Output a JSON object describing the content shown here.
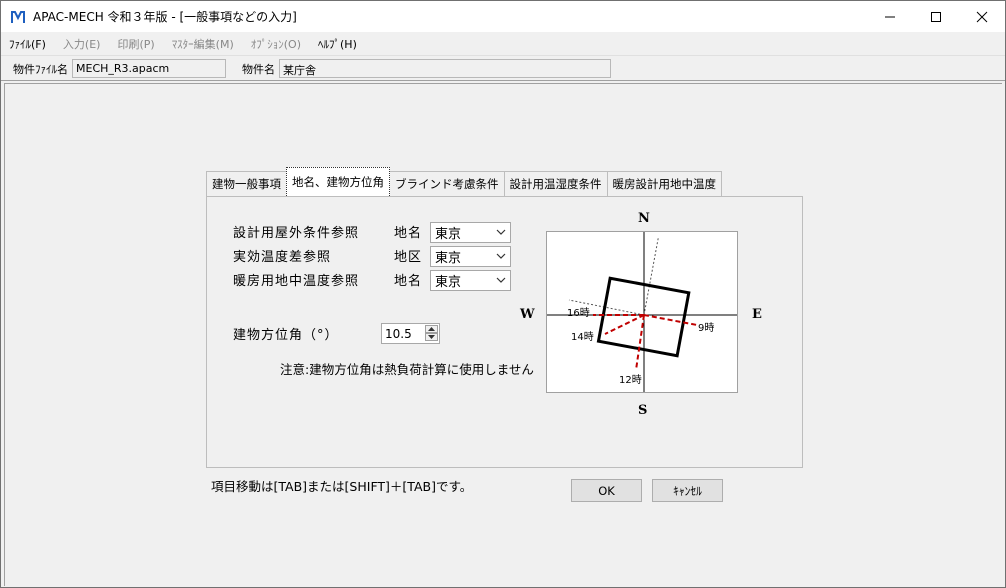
{
  "window": {
    "title": "APAC-MECH 令和３年版 - [一般事項などの入力]"
  },
  "menu": [
    {
      "label": "ﾌｧｲﾙ(F)",
      "enabled": true
    },
    {
      "label": "入力(E)",
      "enabled": false
    },
    {
      "label": "印刷(P)",
      "enabled": false
    },
    {
      "label": "ﾏｽﾀｰ編集(M)",
      "enabled": false
    },
    {
      "label": "ｵﾌﾟｼｮﾝ(O)",
      "enabled": false
    },
    {
      "label": "ﾍﾙﾌﾟ(H)",
      "enabled": true
    }
  ],
  "info": {
    "file_label": "物件ﾌｧｲﾙ名",
    "file_value": "MECH_R3.apacm",
    "name_label": "物件名",
    "name_value": "某庁舎"
  },
  "tabs": [
    {
      "label": "建物一般事項",
      "active": false
    },
    {
      "label": "地名、建物方位角",
      "active": true
    },
    {
      "label": "ブラインド考慮条件",
      "active": false
    },
    {
      "label": "設計用温湿度条件",
      "active": false
    },
    {
      "label": "暖房設計用地中温度",
      "active": false
    }
  ],
  "form": {
    "row1_label": "設計用屋外条件参照",
    "row1_sub": "地名",
    "row1_value": "東京",
    "row2_label": "実効温度差参照",
    "row2_sub": "地区",
    "row2_value": "東京",
    "row3_label": "暖房用地中温度参照",
    "row3_sub": "地名",
    "row3_value": "東京",
    "azimuth_label": "建物方位角（°）",
    "azimuth_value": "10.5",
    "note": "注意:建物方位角は熱負荷計算に使用しません"
  },
  "compass": {
    "n": "N",
    "s": "S",
    "e": "E",
    "w": "W",
    "t16": "16時",
    "t14": "14時",
    "t12": "12時",
    "t9": "9時",
    "azimuth_deg": 10.5
  },
  "footer": {
    "hint": "項目移動は[TAB]または[SHIFT]＋[TAB]です。",
    "ok_label": "OK",
    "cancel_label": "ｷｬﾝｾﾙ"
  },
  "colors": {
    "sun_ray": "#c00000",
    "title_icon": "#1e5fbf"
  }
}
